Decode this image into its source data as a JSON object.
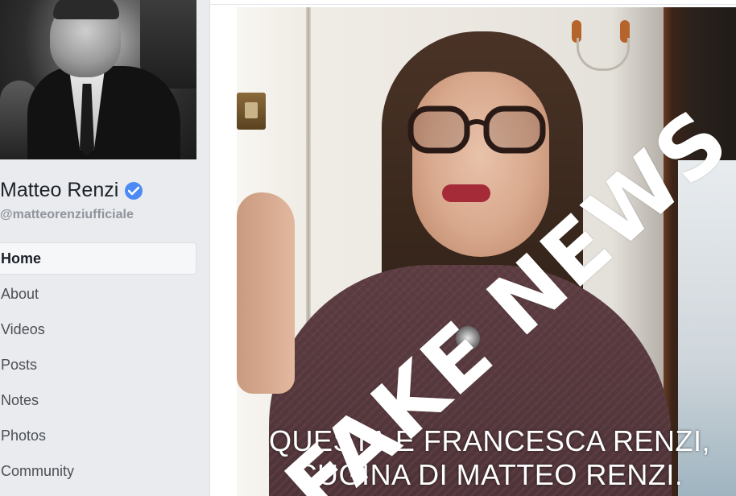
{
  "profile": {
    "name": "Matteo Renzi",
    "handle": "@matteorenziufficiale",
    "verified": true,
    "verified_color": "#4c8bf5"
  },
  "nav": {
    "items": [
      {
        "label": "Home",
        "active": true
      },
      {
        "label": "About"
      },
      {
        "label": "Videos"
      },
      {
        "label": "Posts"
      },
      {
        "label": "Notes"
      },
      {
        "label": "Photos"
      },
      {
        "label": "Community"
      }
    ]
  },
  "post": {
    "overlay_text": "FAKE NEWS",
    "caption_lines": [
      "QUESTA È FRANCESCA RENZI,",
      "CUGINA DI MATTEO RENZI."
    ]
  }
}
